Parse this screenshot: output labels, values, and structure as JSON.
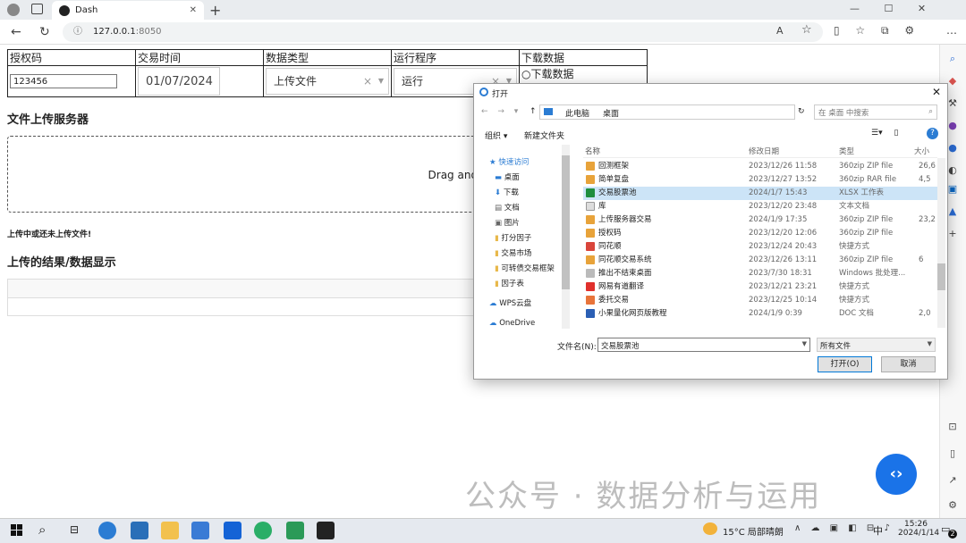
{
  "browser": {
    "tab_title": "Dash",
    "url_host": "127.0.0.1",
    "url_port": ":8050"
  },
  "page": {
    "headers": [
      "授权码",
      "交易时间",
      "数据类型",
      "运行程序",
      "下载数据"
    ],
    "auth_code_value": "123456",
    "date_value": "01/07/2024",
    "data_type_value": "上传文件",
    "run_value": "运行",
    "download_label": "下载数据",
    "upload_server_title": "文件上传服务器",
    "dropzone_text": "Drag and Drop F",
    "upload_status": "上传中或还未上传文件!",
    "results_title": "上传的结果/数据显示"
  },
  "dialog": {
    "title": "打开",
    "breadcrumb": [
      "此电脑",
      "桌面"
    ],
    "search_placeholder": "在 桌面 中搜索",
    "organize": "组织 ▾",
    "new_folder": "新建文件夹",
    "columns": [
      "名称",
      "修改日期",
      "类型",
      "大小"
    ],
    "tree": [
      "快速访问",
      "桌面",
      "下载",
      "文档",
      "图片",
      "打分因子",
      "交易市场",
      "可转债交易框架",
      "因子表",
      "WPS云盘",
      "OneDrive"
    ],
    "files": [
      {
        "name": "回测框架",
        "date": "2023/12/26 11:58",
        "type": "360zip ZIP file",
        "size": "26,6"
      },
      {
        "name": "简单复盘",
        "date": "2023/12/27 13:52",
        "type": "360zip RAR file",
        "size": "4,5"
      },
      {
        "name": "交易股票池",
        "date": "2024/1/7 15:43",
        "type": "XLSX 工作表",
        "size": ""
      },
      {
        "name": "库",
        "date": "2023/12/20 23:48",
        "type": "文本文档",
        "size": ""
      },
      {
        "name": "上传服务器交易",
        "date": "2024/1/9 17:35",
        "type": "360zip ZIP file",
        "size": "23,2"
      },
      {
        "name": "授权码",
        "date": "2023/12/20 12:06",
        "type": "360zip ZIP file",
        "size": ""
      },
      {
        "name": "同花顺",
        "date": "2023/12/24 20:43",
        "type": "快捷方式",
        "size": ""
      },
      {
        "name": "同花顺交易系统",
        "date": "2023/12/26 13:11",
        "type": "360zip ZIP file",
        "size": "6"
      },
      {
        "name": "推出不结束桌面",
        "date": "2023/7/30 18:31",
        "type": "Windows 批处理...",
        "size": ""
      },
      {
        "name": "网易有道翻译",
        "date": "2023/12/21 23:21",
        "type": "快捷方式",
        "size": ""
      },
      {
        "name": "委托交易",
        "date": "2023/12/25 10:14",
        "type": "快捷方式",
        "size": ""
      },
      {
        "name": "小果量化网页版教程",
        "date": "2024/1/9 0:39",
        "type": "DOC 文档",
        "size": "2,0"
      }
    ],
    "filename_label": "文件名(N):",
    "filename_value": "交易股票池",
    "filter_value": "所有文件",
    "open_btn": "打开(O)",
    "cancel_btn": "取消"
  },
  "taskbar": {
    "weather": "15°C 局部晴朗",
    "time": "15:26",
    "date": "2024/1/14",
    "lang": "中",
    "notif_count": "2"
  },
  "watermark": "公众号 · 数据分析与运用"
}
